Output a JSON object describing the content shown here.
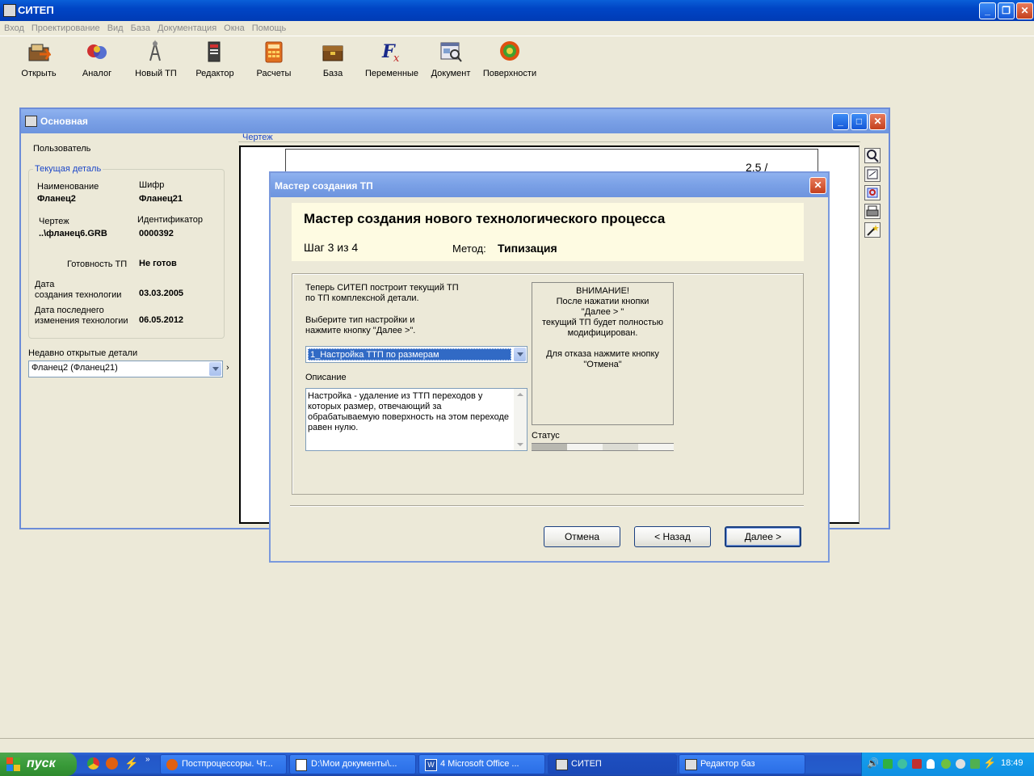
{
  "app": {
    "title": "СИТЕП"
  },
  "menu": [
    "Вход",
    "Проектирование",
    "Вид",
    "База",
    "Документация",
    "Окна",
    "Помощь"
  ],
  "toolbar": [
    {
      "label": "Открыть",
      "icon": "open-icon"
    },
    {
      "label": "Аналог",
      "icon": "analog-icon"
    },
    {
      "label": "Новый ТП",
      "icon": "new-tp-icon"
    },
    {
      "label": "Редактор",
      "icon": "editor-icon"
    },
    {
      "label": "Расчеты",
      "icon": "calculator-icon"
    },
    {
      "label": "База",
      "icon": "database-icon"
    },
    {
      "label": "Переменные",
      "icon": "fx-icon"
    },
    {
      "label": "Документ",
      "icon": "document-icon"
    },
    {
      "label": "Поверхности",
      "icon": "surfaces-icon"
    }
  ],
  "main_window": {
    "title": "Основная",
    "user_label": "Пользователь",
    "group_title": "Текущая деталь",
    "name_label": "Наименование",
    "name_value": "Фланец2",
    "code_label": "Шифр",
    "code_value": "Фланец21",
    "drawing_label": "Чертеж",
    "drawing_value": "..\\фланец6.GRB",
    "id_label": "Идентификатор",
    "id_value": "0000392",
    "ready_label": "Готовность ТП",
    "ready_value": "Не готов",
    "created_label_1": "Дата",
    "created_label_2": "создания технологии",
    "created_value": "03.03.2005",
    "modified_label_1": "Дата последнего",
    "modified_label_2": "изменения технологии",
    "modified_value": "06.05.2012",
    "recent_label": "Недавно открытые детали",
    "recent_value": "Фланец2 (Фланец21)",
    "drawing_tab": "Чертеж",
    "drawing_text": "2.5 /"
  },
  "wizard": {
    "title": "Мастер создания ТП",
    "header_title": "Мастер создания нового технологического процесса",
    "step": "Шаг 3 из 4",
    "method_label": "Метод:",
    "method_value": "Типизация",
    "intro_1": "Теперь СИТЕП построит текущий ТП",
    "intro_2": "по ТП комплексной детали.",
    "choose_1": "Выберите тип настройки и",
    "choose_2": "нажмите кнопку \"Далее >\".",
    "select_value": "1_Настройка ТТП по размерам",
    "description_label": "Описание",
    "description_lines": [
      "Настройка - удаление из ТТП переходов у",
      "которых размер, отвечающий за",
      "обрабатываемую поверхность на этом переходе",
      "равен нулю."
    ],
    "warning_lines": [
      "ВНИМАНИЕ!",
      "После нажатии кнопки",
      "\"Далее > \"",
      "текущий ТП будет полностью",
      "модифицирован.",
      "",
      "Для отказа нажмите кнопку",
      "\"Отмена\""
    ],
    "status_label": "Статус",
    "buttons": {
      "cancel": "Отмена",
      "back": "< Назад",
      "next": "Далее >"
    }
  },
  "taskbar": {
    "start": "пуск",
    "tasks": [
      "Постпроцессоры. Чт...",
      "D:\\Мои документы\\...",
      "4 Microsoft Office ...",
      "СИТЕП",
      "Редактор баз"
    ],
    "clock": "18:49"
  }
}
